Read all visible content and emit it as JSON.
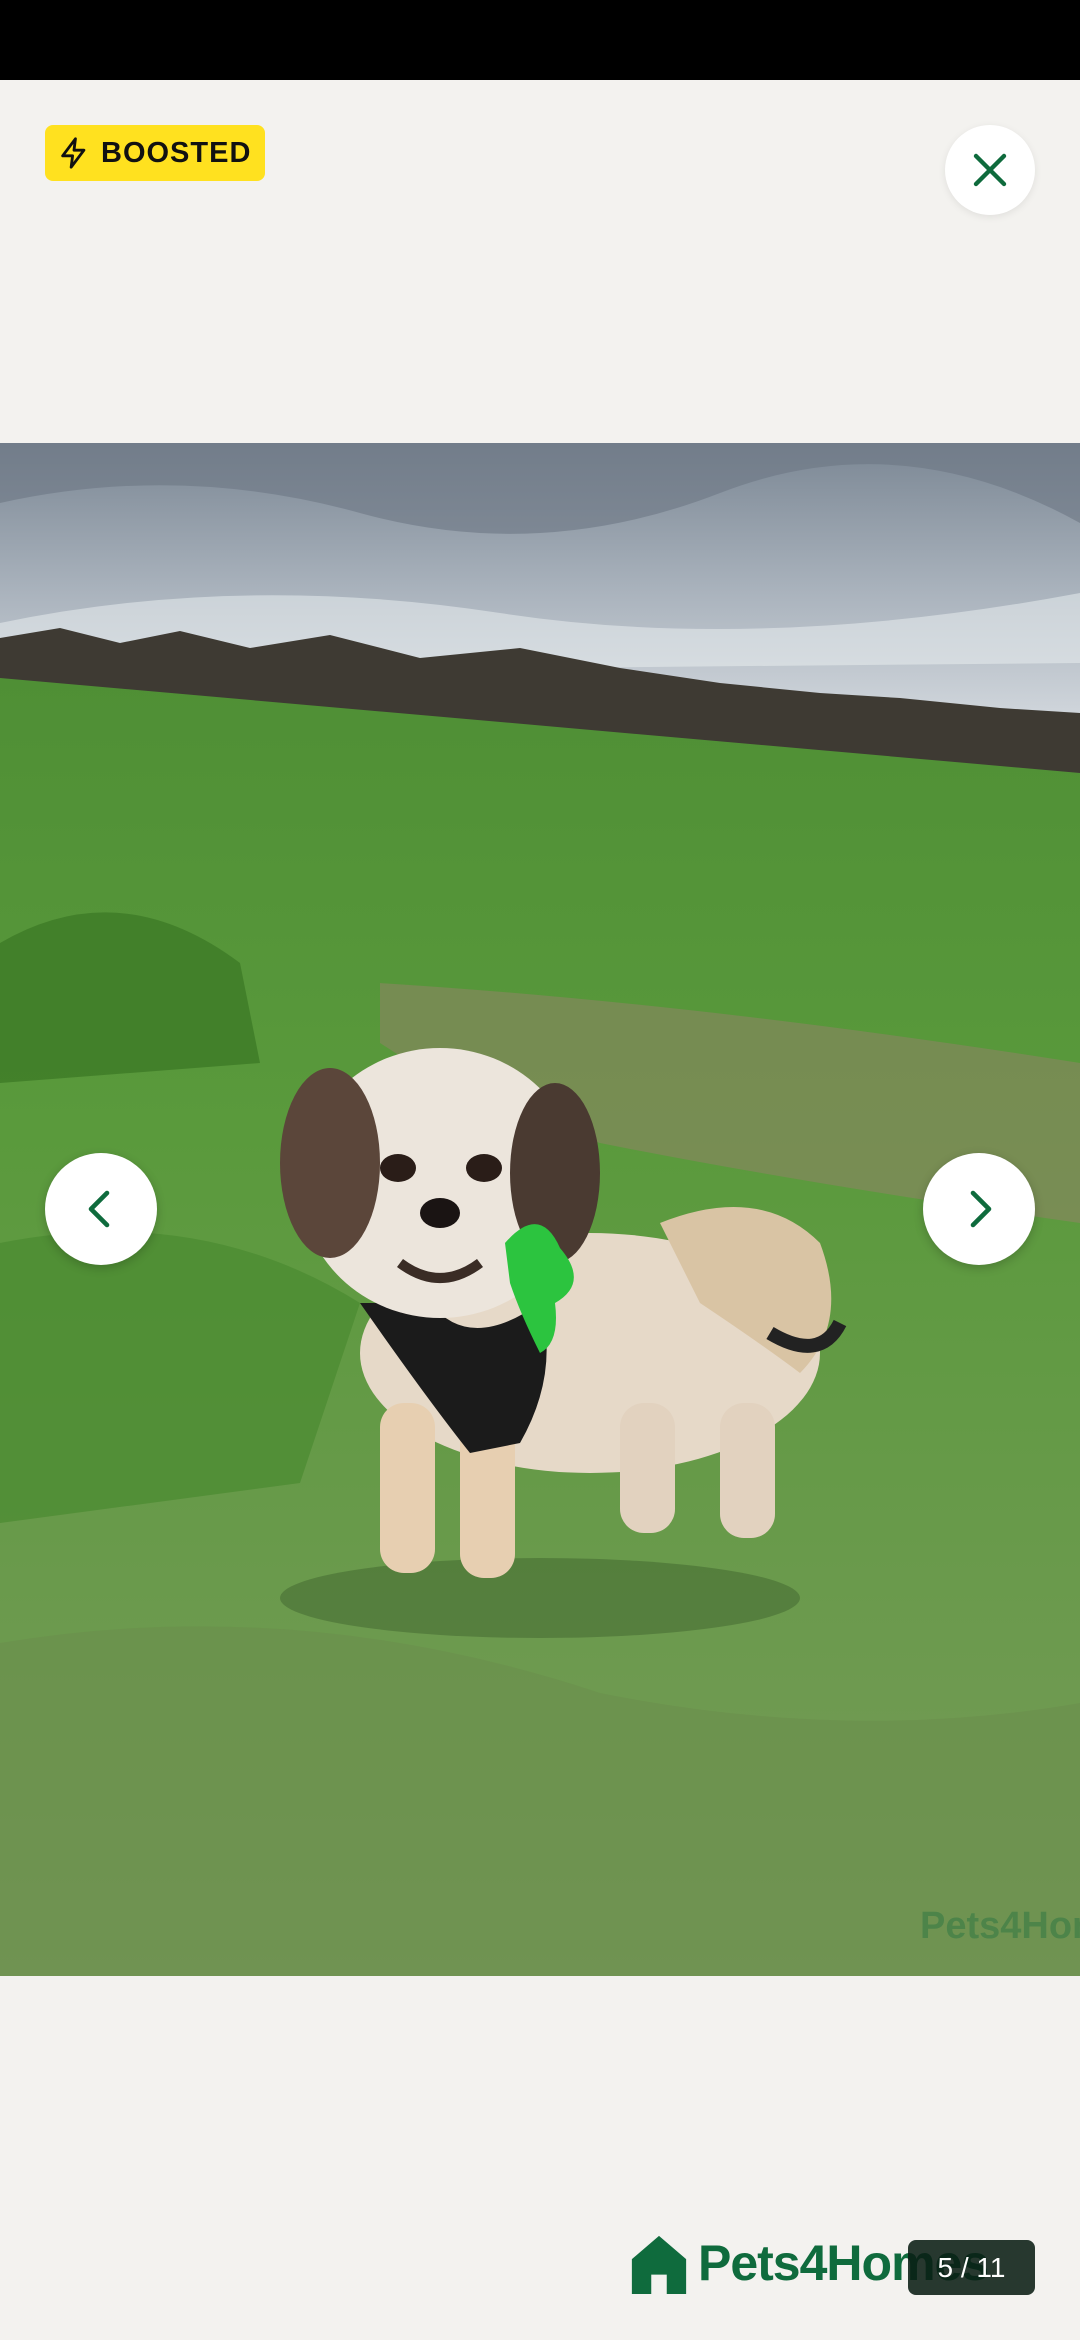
{
  "badge": {
    "label": "BOOSTED",
    "icon": "lightning-icon",
    "color": "#ffe11f"
  },
  "close": {
    "icon": "close-icon",
    "color": "#0f6b3d"
  },
  "photo": {
    "description_icon": "dog-photo"
  },
  "navigation": {
    "prev_icon": "chevron-left-icon",
    "next_icon": "chevron-right-icon"
  },
  "brand": {
    "name": "Pets4Homes",
    "color": "#0f6b3d"
  },
  "counter": {
    "text": "5 / 11"
  }
}
